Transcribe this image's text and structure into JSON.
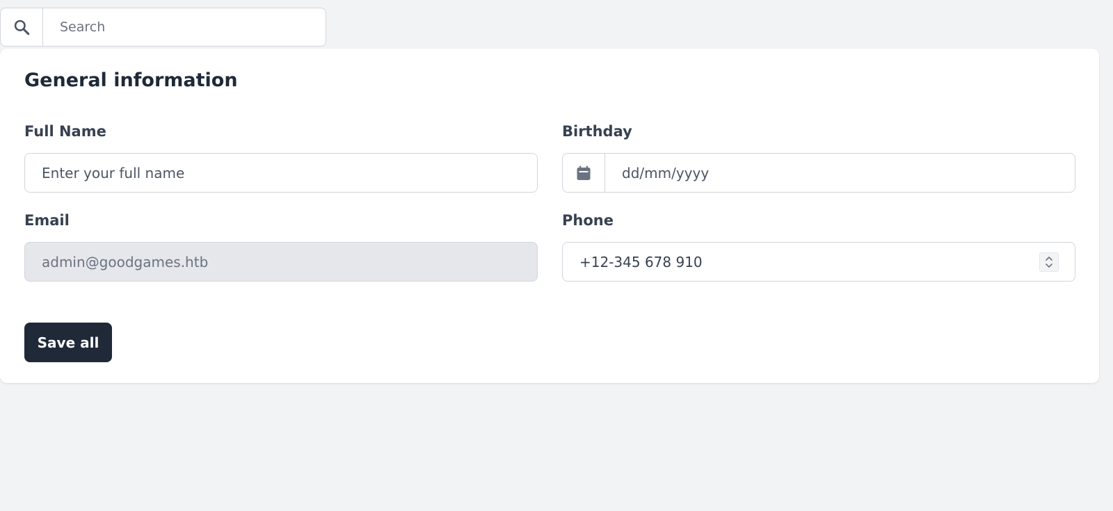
{
  "search": {
    "placeholder": "Search",
    "icon": "search-icon"
  },
  "form": {
    "title": "General information",
    "full_name": {
      "label": "Full Name",
      "placeholder": "Enter your full name",
      "value": ""
    },
    "birthday": {
      "label": "Birthday",
      "placeholder": "dd/mm/yyyy",
      "value": "",
      "icon": "calendar-icon"
    },
    "email": {
      "label": "Email",
      "value": "admin@goodgames.htb",
      "disabled": true
    },
    "phone": {
      "label": "Phone",
      "value": "+12-345 678 910",
      "icon": "spinner-icon"
    },
    "save_label": "Save all"
  },
  "colors": {
    "page_background": "#f2f3f5",
    "card_background": "#ffffff",
    "primary_button": "#1f2937",
    "border": "#d1d5db",
    "disabled_field": "#e5e7eb"
  }
}
